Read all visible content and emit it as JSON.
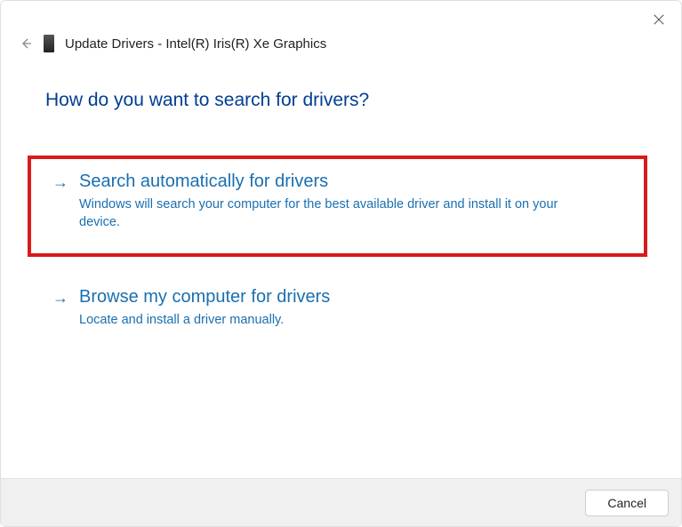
{
  "window": {
    "title": "Update Drivers - Intel(R) Iris(R) Xe Graphics"
  },
  "heading": "How do you want to search for drivers?",
  "options": [
    {
      "title": "Search automatically for drivers",
      "description": "Windows will search your computer for the best available driver and install it on your device.",
      "highlighted": true
    },
    {
      "title": "Browse my computer for drivers",
      "description": "Locate and install a driver manually.",
      "highlighted": false
    }
  ],
  "footer": {
    "cancel_label": "Cancel"
  },
  "colors": {
    "heading": "#003e92",
    "link": "#1a6fb0",
    "highlight_border": "#d91a1a"
  }
}
